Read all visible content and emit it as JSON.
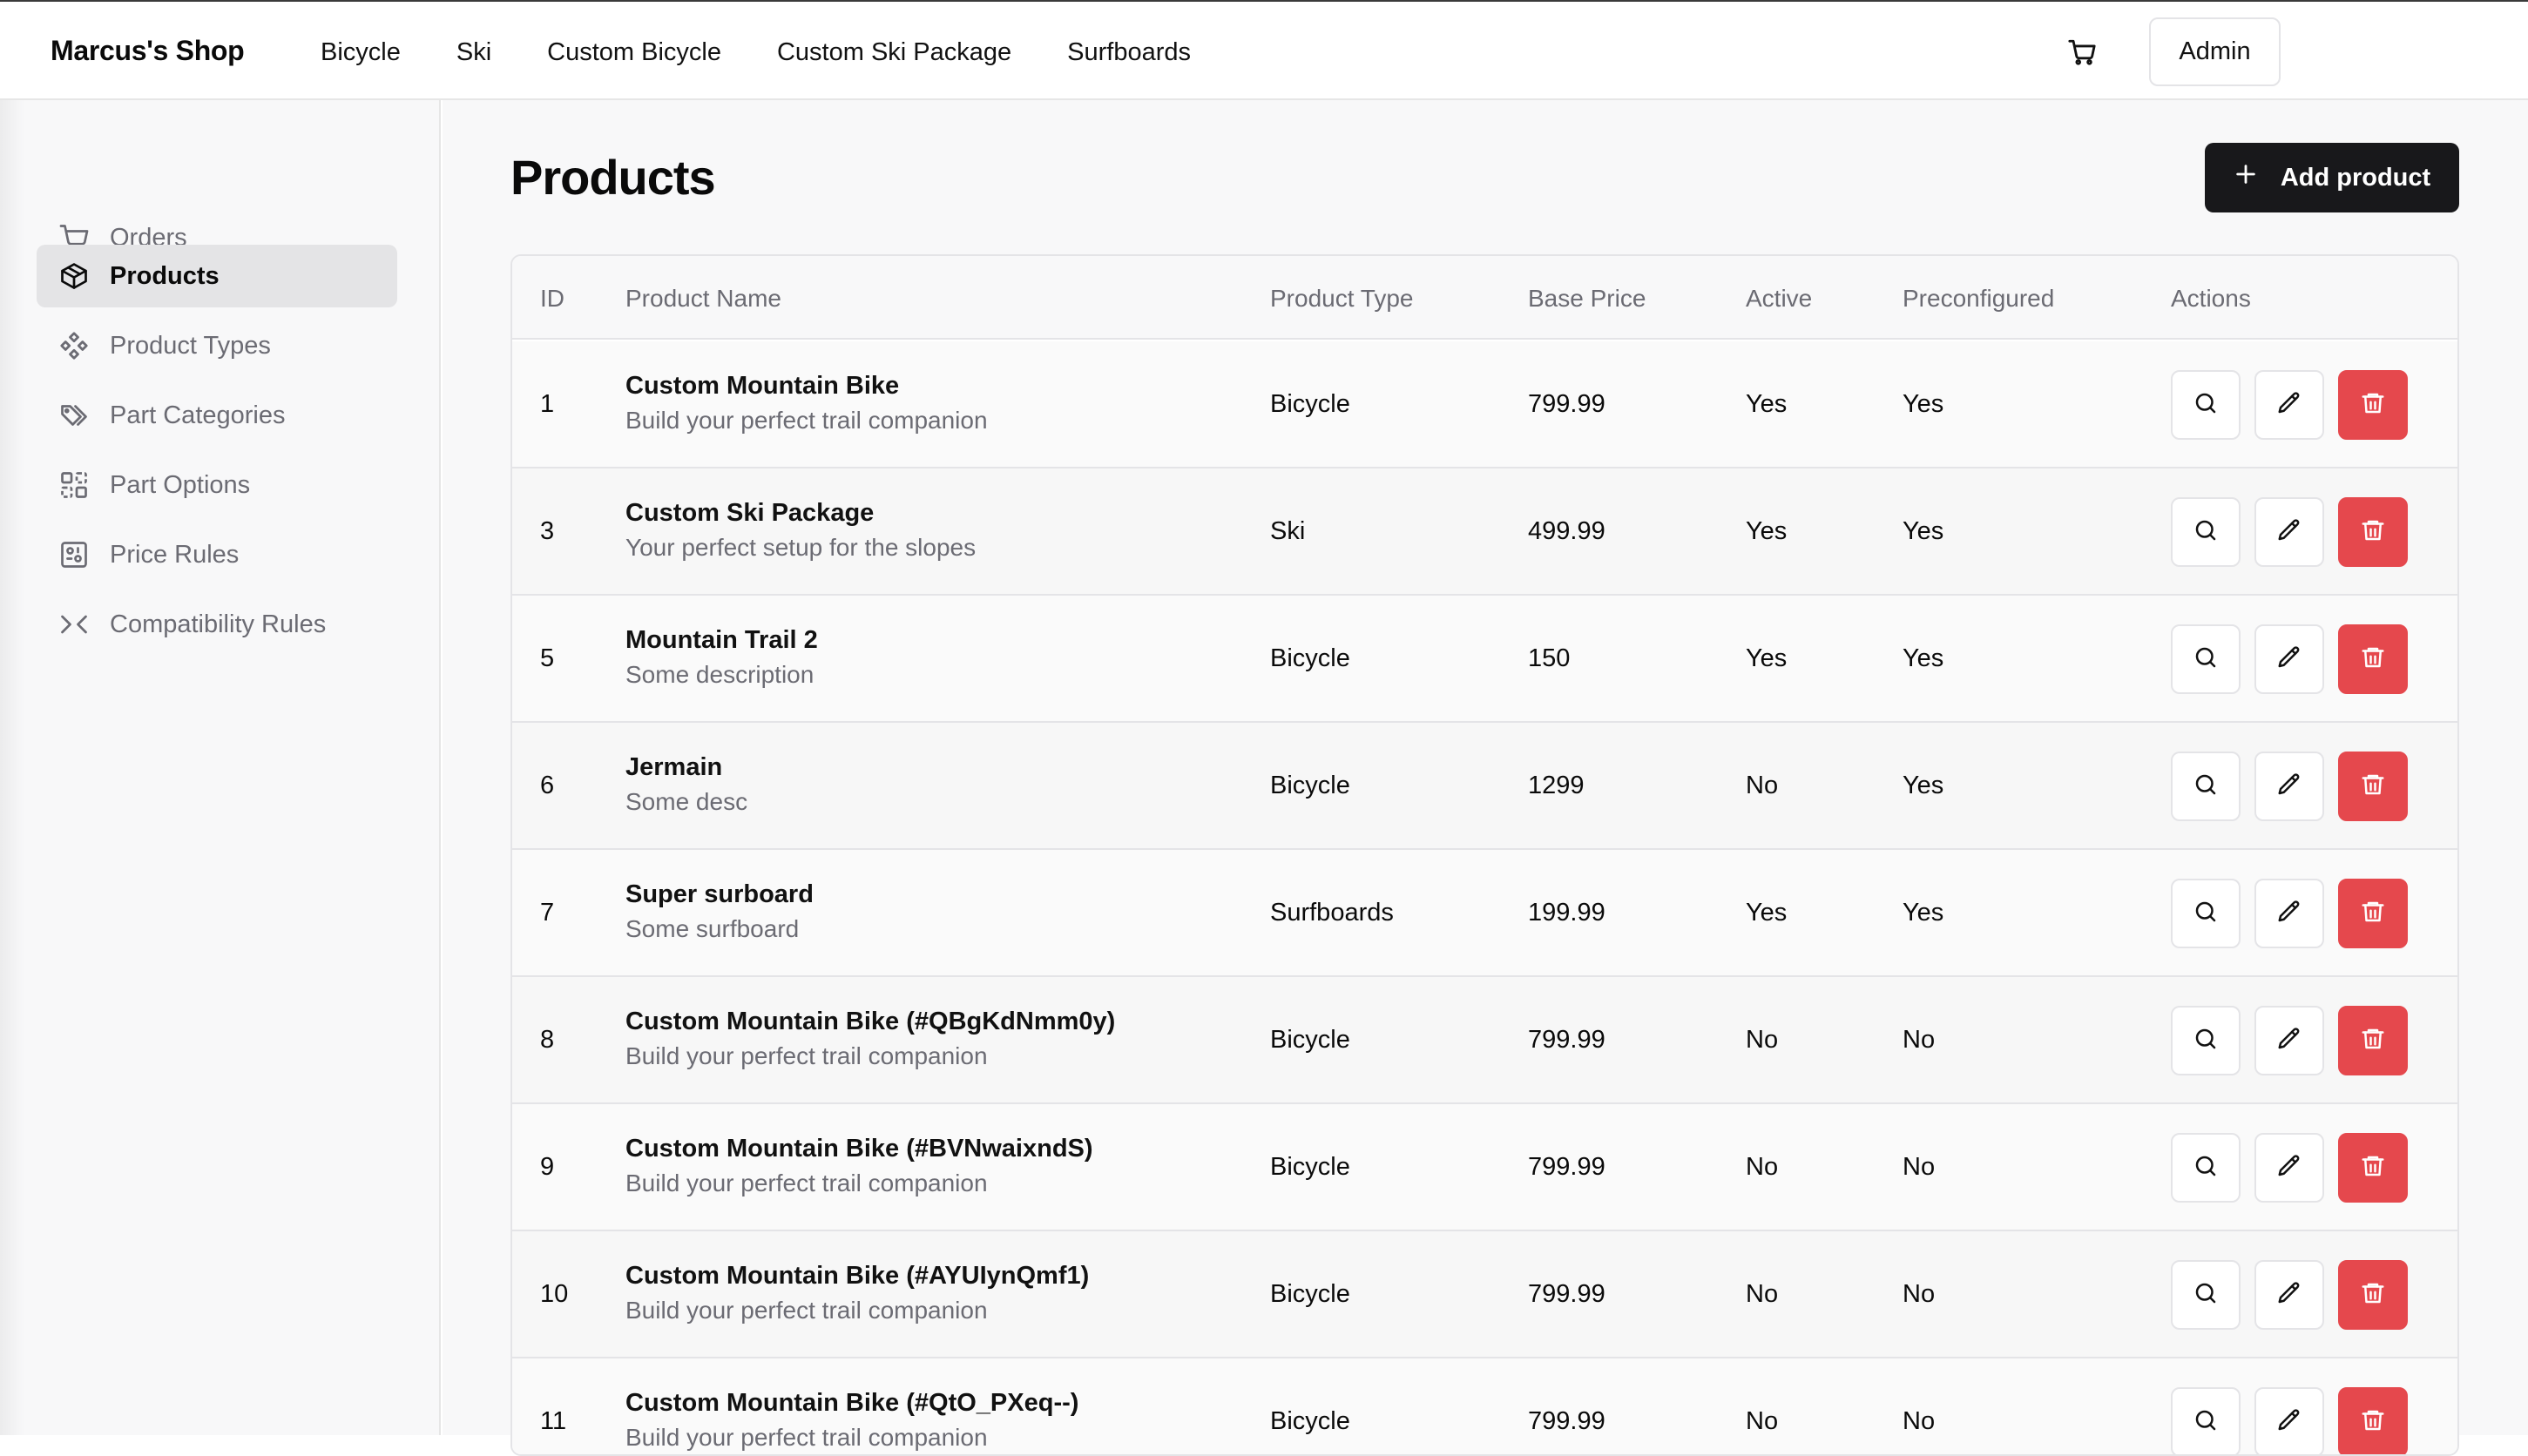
{
  "header": {
    "brand": "Marcus's Shop",
    "nav": [
      "Bicycle",
      "Ski",
      "Custom Bicycle",
      "Custom Ski Package",
      "Surfboards"
    ],
    "cart_icon": "shopping-cart-icon",
    "admin_label": "Admin"
  },
  "sidebar": {
    "items": [
      {
        "label": "Orders",
        "icon": "shopping-cart-icon",
        "active": false
      },
      {
        "label": "Products",
        "icon": "package-icon",
        "active": true
      },
      {
        "label": "Product Types",
        "icon": "component-icon",
        "active": false
      },
      {
        "label": "Part Categories",
        "icon": "tags-icon",
        "active": false
      },
      {
        "label": "Part Options",
        "icon": "layout-grid-icon",
        "active": false
      },
      {
        "label": "Price Rules",
        "icon": "receipt-icon",
        "active": false
      },
      {
        "label": "Compatibility Rules",
        "icon": "merge-icon",
        "active": false
      }
    ]
  },
  "main": {
    "title": "Products",
    "add_button_label": "Add product",
    "columns": [
      "ID",
      "Product Name",
      "Product Type",
      "Base Price",
      "Active",
      "Preconfigured",
      "Actions"
    ],
    "rows": [
      {
        "id": "1",
        "name": "Custom Mountain Bike",
        "desc": "Build your perfect trail companion",
        "type": "Bicycle",
        "price": "799.99",
        "active": "Yes",
        "preconfigured": "Yes"
      },
      {
        "id": "3",
        "name": "Custom Ski Package",
        "desc": "Your perfect setup for the slopes",
        "type": "Ski",
        "price": "499.99",
        "active": "Yes",
        "preconfigured": "Yes"
      },
      {
        "id": "5",
        "name": "Mountain Trail 2",
        "desc": "Some description",
        "type": "Bicycle",
        "price": "150",
        "active": "Yes",
        "preconfigured": "Yes"
      },
      {
        "id": "6",
        "name": "Jermain",
        "desc": "Some desc",
        "type": "Bicycle",
        "price": "1299",
        "active": "No",
        "preconfigured": "Yes"
      },
      {
        "id": "7",
        "name": "Super surboard",
        "desc": "Some surfboard",
        "type": "Surfboards",
        "price": "199.99",
        "active": "Yes",
        "preconfigured": "Yes"
      },
      {
        "id": "8",
        "name": "Custom Mountain Bike (#QBgKdNmm0y)",
        "desc": "Build your perfect trail companion",
        "type": "Bicycle",
        "price": "799.99",
        "active": "No",
        "preconfigured": "No"
      },
      {
        "id": "9",
        "name": "Custom Mountain Bike (#BVNwaixndS)",
        "desc": "Build your perfect trail companion",
        "type": "Bicycle",
        "price": "799.99",
        "active": "No",
        "preconfigured": "No"
      },
      {
        "id": "10",
        "name": "Custom Mountain Bike (#AYUIynQmf1)",
        "desc": "Build your perfect trail companion",
        "type": "Bicycle",
        "price": "799.99",
        "active": "No",
        "preconfigured": "No"
      },
      {
        "id": "11",
        "name": "Custom Mountain Bike (#QtO_PXeq--)",
        "desc": "Build your perfect trail companion",
        "type": "Bicycle",
        "price": "799.99",
        "active": "No",
        "preconfigured": "No"
      }
    ],
    "action_icons": [
      "search-icon",
      "pencil-icon",
      "trash-icon"
    ],
    "colors": {
      "delete": "#e5484d",
      "primary": "#18181b"
    }
  }
}
